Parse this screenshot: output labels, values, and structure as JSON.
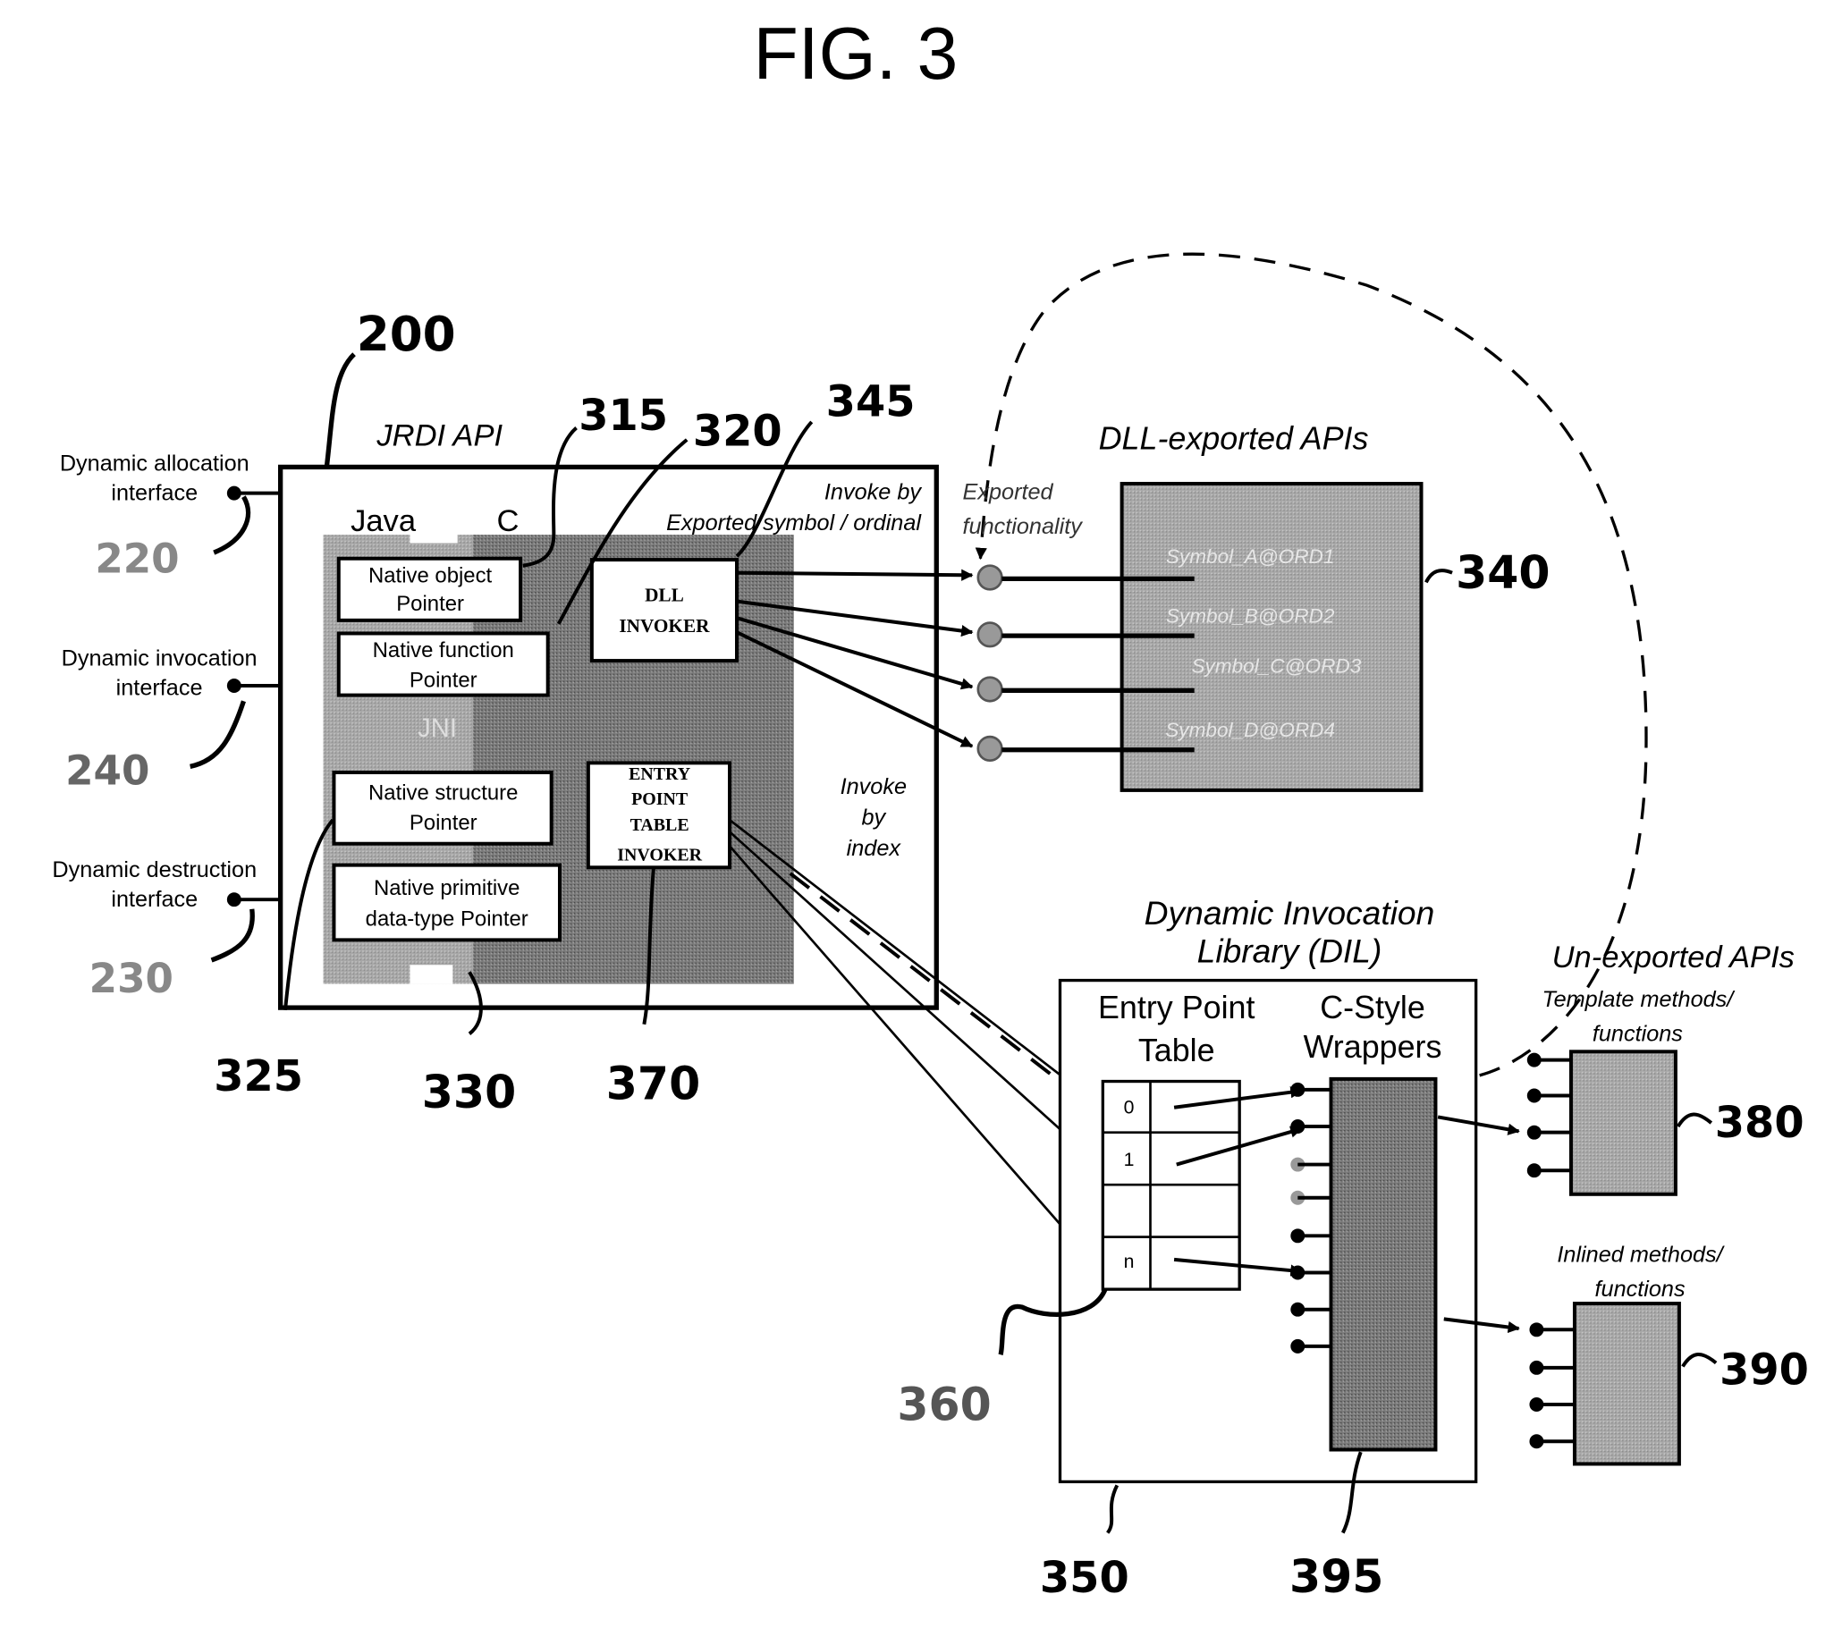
{
  "title": "FIG. 3",
  "colors": {
    "ink": "#000000",
    "dark_fill": "#6e6e6e",
    "mid_fill": "#9a9a9a",
    "light_fill": "#bdbdbd",
    "paper": "#ffffff"
  },
  "interfaces": [
    {
      "line1": "Dynamic allocation",
      "line2": "interface",
      "ref": "220"
    },
    {
      "line1": "Dynamic invocation",
      "line2": "interface",
      "ref": "240"
    },
    {
      "line1": "Dynamic destruction",
      "line2": "interface",
      "ref": "230"
    }
  ],
  "jrdi": {
    "title": "JRDI API",
    "ref": "200",
    "java_label": "Java",
    "c_label": "C",
    "jni_label": "JNI",
    "invoke_symbol_line1": "Invoke by",
    "invoke_symbol_line2": "Exported symbol / ordinal",
    "invoke_index_line1": "Invoke",
    "invoke_index_line2": "by",
    "invoke_index_line3": "index",
    "pointers": [
      {
        "line1": "Native object",
        "line2": "Pointer"
      },
      {
        "line1": "Native function",
        "line2": "Pointer"
      },
      {
        "line1": "Native structure",
        "line2": "Pointer"
      },
      {
        "line1": "Native primitive",
        "line2": "data-type Pointer"
      }
    ],
    "dll_invoker": {
      "line1": "DLL",
      "line2": "INVOKER"
    },
    "ept_invoker": {
      "line1": "ENTRY",
      "line2": "POINT",
      "line3": "TABLE",
      "line4": "INVOKER"
    },
    "refs": {
      "r315": "315",
      "r320": "320",
      "r345": "345",
      "r325": "325",
      "r330": "330",
      "r370": "370"
    }
  },
  "dll_exported": {
    "title": "DLL-exported APIs",
    "ref": "340",
    "exported_line1": "Exported",
    "exported_line2": "functionality",
    "symbols": [
      "Symbol_A@ORD1",
      "Symbol_B@ORD2",
      "Symbol_C@ORD3",
      "Symbol_D@ORD4"
    ]
  },
  "dil": {
    "title_line1": "Dynamic Invocation",
    "title_line2": "Library (DIL)",
    "ref": "350",
    "ept_line1": "Entry Point",
    "ept_line2": "Table",
    "ept_ref": "360",
    "rows": [
      "0",
      "1",
      "",
      "n"
    ],
    "wrappers_line1": "C-Style",
    "wrappers_line2": "Wrappers",
    "wrappers_ref": "395"
  },
  "unexported": {
    "title": "Un-exported APIs",
    "template_line1": "Template methods/",
    "template_line2": "functions",
    "template_ref": "380",
    "inlined_line1": "Inlined methods/",
    "inlined_line2": "functions",
    "inlined_ref": "390"
  }
}
